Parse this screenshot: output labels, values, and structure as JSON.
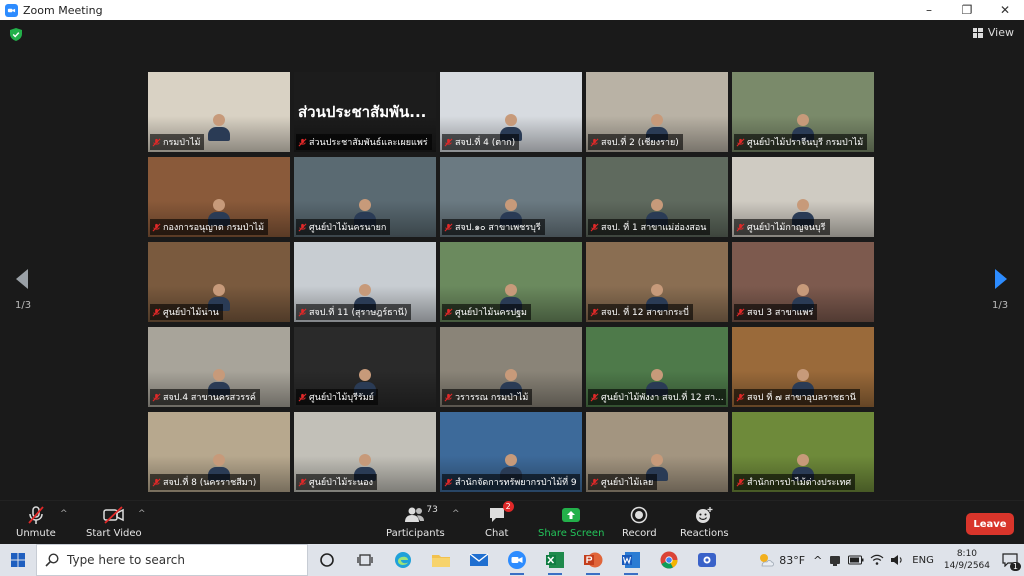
{
  "window": {
    "title": "Zoom Meeting",
    "minimize": "–",
    "maximize": "❐",
    "close": "✕"
  },
  "meeting": {
    "view_label": "View",
    "page_left": "1/3",
    "page_right": "1/3",
    "big_tile_text": "ส่วนประชาสัมพัน...",
    "tiles": [
      {
        "name": "กรมป่าไม้",
        "color": "#d9d2c4"
      },
      {
        "name": "ส่วนประชาสัมพันธ์และเผยแพร่",
        "color": "#1c1c1c"
      },
      {
        "name": "สจป.ที่ 4 (ตาก)",
        "color": "#d7dbe0"
      },
      {
        "name": "สจป.ที่ 2 (เชียงราย)",
        "color": "#b9b2a5"
      },
      {
        "name": "ศูนย์ป่าไม้ปราจีนบุรี กรมป่าไม้",
        "color": "#7a8a6a"
      },
      {
        "name": "กองการอนุญาต กรมป่าไม้",
        "color": "#8a5a3a"
      },
      {
        "name": "ศูนย์ป่าไม้นครนายก",
        "color": "#5a6a72"
      },
      {
        "name": "สจป.๑๐ สาขาเพชรบุรี",
        "color": "#6b7a82"
      },
      {
        "name": "สจป. ที่ 1 สาขาแม่ฮ่องสอน",
        "color": "#5f6a5e"
      },
      {
        "name": "ศูนย์ป่าไม้กาญจนบุรี",
        "color": "#cfcbc2"
      },
      {
        "name": "ศูนย์ป่าไม้น่าน",
        "color": "#7a5a3e"
      },
      {
        "name": "สจป.ที่ 11 (สุราษฎร์ธานี)",
        "color": "#c8cdd2"
      },
      {
        "name": "ศูนย์ป่าไม้นครปฐม",
        "color": "#6b8a5e"
      },
      {
        "name": "สจป. ที่ 12 สาขากระบี่",
        "color": "#8a6e52"
      },
      {
        "name": "สจป 3 สาขาแพร่",
        "color": "#7d5a4e"
      },
      {
        "name": "สจป.4 สาขานครสวรรค์",
        "color": "#a8a49a"
      },
      {
        "name": "ศูนย์ป่าไม้บุรีรัมย์",
        "color": "#2a2a2a"
      },
      {
        "name": "วรารรณ กรมป่าไม้",
        "color": "#8a8478"
      },
      {
        "name": "ศูนย์ป่าไม้พังงา สจป.ที่ 12 สา...",
        "color": "#4e7a4a"
      },
      {
        "name": "สจป ที่ ๗ สาขาอุบลราชธานี",
        "color": "#9a6a3a"
      },
      {
        "name": "สจป.ที่ 8 (นครราชสีมา)",
        "color": "#b7a88e"
      },
      {
        "name": "ศูนย์ป่าไม้ระนอง",
        "color": "#c2c0b8"
      },
      {
        "name": "สำนักจัดการทรัพยากรป่าไม้ที่ 9 ส...",
        "color": "#3d6a9a"
      },
      {
        "name": "ศูนย์ป่าไม้เลย",
        "color": "#a39580"
      },
      {
        "name": "สำนักการป่าไม้ต่างประเทศ",
        "color": "#6e8a3a"
      }
    ]
  },
  "toolbar": {
    "unmute": "Unmute",
    "start_video": "Start Video",
    "participants": "Participants",
    "participants_count": "73",
    "chat": "Chat",
    "chat_badge": "2",
    "share_screen": "Share Screen",
    "record": "Record",
    "reactions": "Reactions",
    "leave": "Leave",
    "caret": "^"
  },
  "taskbar": {
    "search_placeholder": "Type here to search",
    "weather": "83°F",
    "language": "ENG",
    "time": "8:10",
    "date": "14/9/2564",
    "notification_count": "1",
    "tray_chevron": "^"
  }
}
